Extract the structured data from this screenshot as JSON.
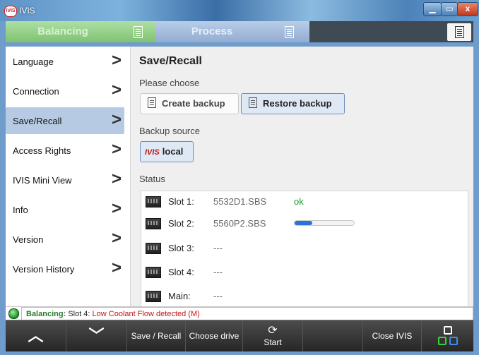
{
  "window": {
    "title": "IVIS",
    "app_icon_text": "IVIS",
    "close_glyph": "x"
  },
  "tabs": [
    {
      "label": "Balancing",
      "state": "active-inactive",
      "color": "#8fcb82"
    },
    {
      "label": "Process",
      "color": "#a7bee0"
    }
  ],
  "sidebar": {
    "items": [
      {
        "label": "Language"
      },
      {
        "label": "Connection"
      },
      {
        "label": "Save/Recall",
        "active": true
      },
      {
        "label": "Access Rights"
      },
      {
        "label": "IVIS Mini View"
      },
      {
        "label": "Info"
      },
      {
        "label": "Version"
      },
      {
        "label": "Version History"
      }
    ],
    "chevron": ">"
  },
  "main": {
    "title": "Save/Recall",
    "choose_label": "Please choose",
    "create_backup_label": "Create backup",
    "restore_backup_label": "Restore backup",
    "backup_source_label": "Backup source",
    "source_logo": "IVIS",
    "source_label": "local",
    "status_label": "Status",
    "slots": [
      {
        "label": "Slot 1:",
        "file": "5532D1.SBS",
        "state": "ok",
        "state_text": "ok"
      },
      {
        "label": "Slot 2:",
        "file": "5560P2.SBS",
        "state": "progress",
        "progress": 0.3
      },
      {
        "label": "Slot 3:",
        "file": "---"
      },
      {
        "label": "Slot 4:",
        "file": "---"
      },
      {
        "label": "Main:",
        "file": "---"
      }
    ]
  },
  "statusline": {
    "prefix": "Balancing:",
    "slot": "Slot 4:",
    "message": "Low Coolant Flow detected (M)",
    "led_color": "#2fbf3a"
  },
  "bottombar": {
    "up_glyph": "^",
    "down_glyph": "v",
    "save_recall": "Save / Recall",
    "choose_drive": "Choose drive",
    "start": "Start",
    "close": "Close IVIS"
  },
  "icons": [
    "app-icon",
    "document-icon",
    "backup-icon",
    "slot-card-icon",
    "start-icon",
    "network-icon"
  ]
}
